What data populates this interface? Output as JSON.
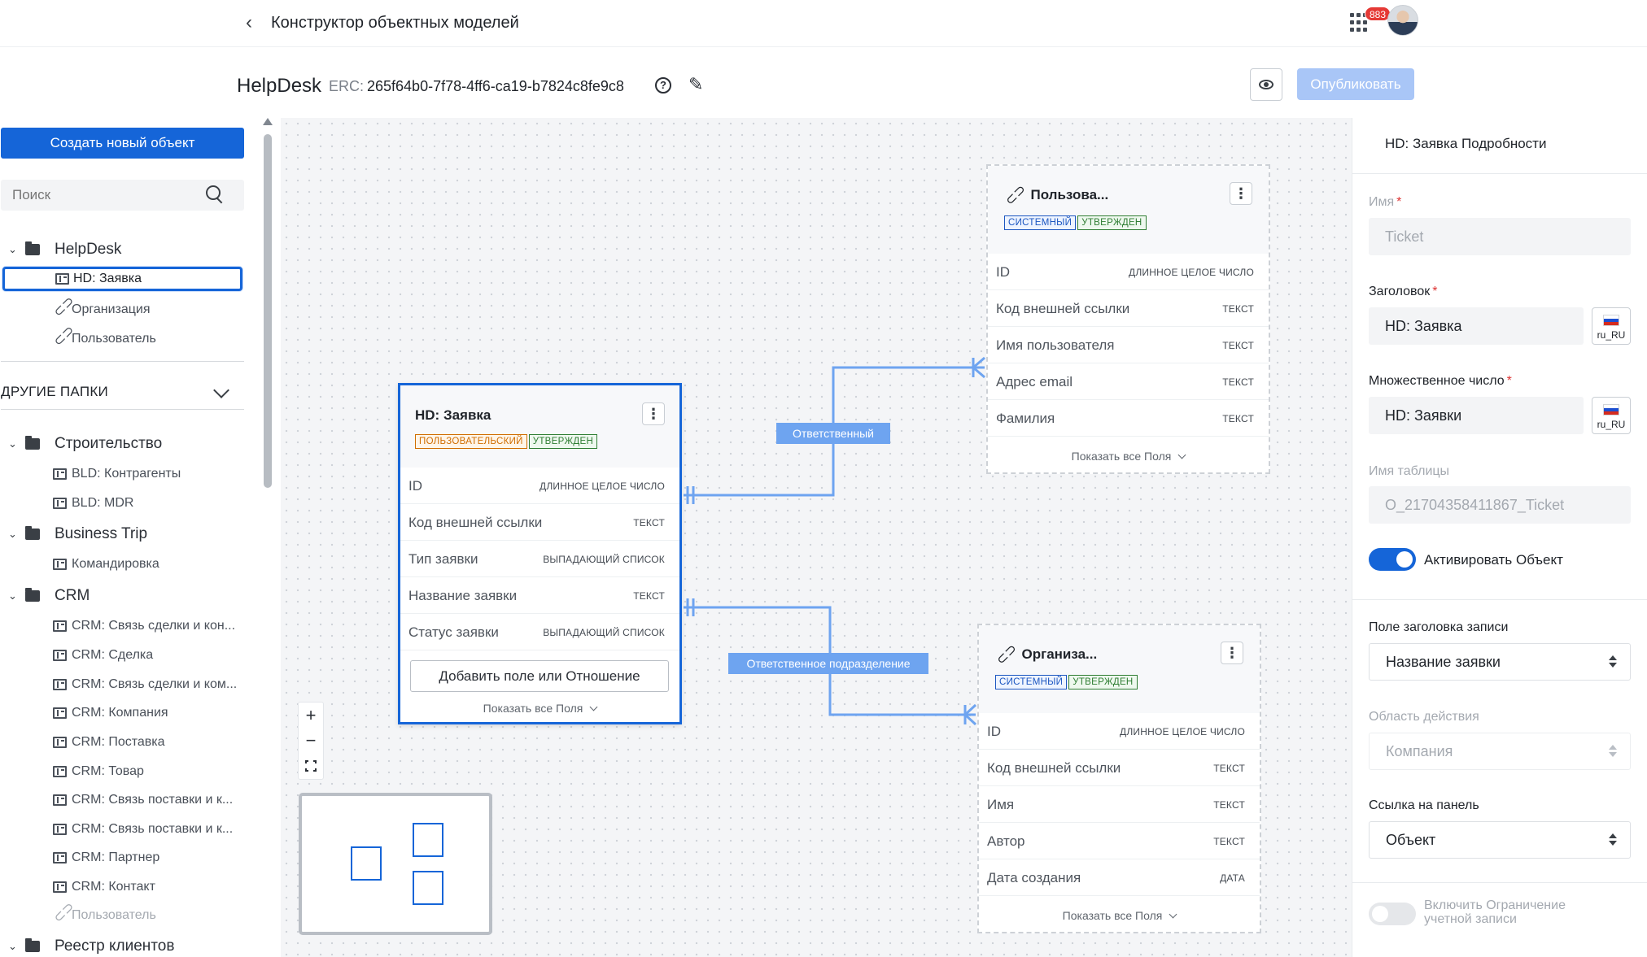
{
  "header": {
    "title": "Конструктор объектных моделей",
    "notifications_count": "883"
  },
  "model": {
    "name": "HelpDesk",
    "erc_label": "ERC:",
    "erc_value": "265f64b0-7f78-4ff6-ca19-b7824c8fe9c8",
    "publish_label": "Опубликовать"
  },
  "sidebar": {
    "create_label": "Создать новый объект",
    "search_placeholder": "Поиск",
    "folder": {
      "label": "HelpDesk",
      "items": [
        {
          "label": "HD: Заявка",
          "type": "object"
        },
        {
          "label": "Организация",
          "type": "link"
        },
        {
          "label": "Пользователь",
          "type": "link"
        }
      ]
    },
    "other_folders_label": "ДРУГИЕ ПАПКИ",
    "groups": [
      {
        "label": "Строительство",
        "items": [
          "BLD: Контрагенты",
          "BLD: MDR"
        ]
      },
      {
        "label": "Business Trip",
        "items": [
          "Командировка"
        ]
      },
      {
        "label": "CRM",
        "items": [
          "CRM: Связь сделки и кон...",
          "CRM: Сделка",
          "CRM: Связь сделки и ком...",
          "CRM: Компания",
          "CRM: Поставка",
          "CRM: Товар",
          "CRM: Связь поставки и к...",
          "CRM: Связь поставки и к...",
          "CRM: Партнер",
          "CRM: Контакт"
        ],
        "link_item": "Пользователь"
      },
      {
        "label": "Реестр клиентов",
        "items": []
      }
    ]
  },
  "canvas": {
    "badges": {
      "system": "СИСТЕМНЫЙ",
      "approved": "УТВЕРЖДЕН",
      "custom": "ПОЛЬЗОВАТЕЛЬСКИЙ"
    },
    "show_all_label": "Показать все Поля",
    "ticket": {
      "title": "HD: Заявка",
      "fields": [
        {
          "name": "ID",
          "type": "ДЛИННОЕ ЦЕЛОЕ ЧИСЛО"
        },
        {
          "name": "Код внешней ссылки",
          "type": "ТЕКСТ"
        },
        {
          "name": "Тип заявки",
          "type": "ВЫПАДАЮЩИЙ СПИСОК"
        },
        {
          "name": "Название заявки",
          "type": "ТЕКСТ"
        },
        {
          "name": "Статус заявки",
          "type": "ВЫПАДАЮЩИЙ СПИСОК"
        }
      ],
      "add_label": "Добавить поле или Отношение"
    },
    "user": {
      "title": "Пользова...",
      "fields": [
        {
          "name": "ID",
          "type": "ДЛИННОЕ ЦЕЛОЕ ЧИСЛО"
        },
        {
          "name": "Код внешней ссылки",
          "type": "ТЕКСТ"
        },
        {
          "name": "Имя пользователя",
          "type": "ТЕКСТ"
        },
        {
          "name": "Адрес email",
          "type": "ТЕКСТ"
        },
        {
          "name": "Фамилия",
          "type": "ТЕКСТ"
        }
      ]
    },
    "org": {
      "title": "Организа...",
      "fields": [
        {
          "name": "ID",
          "type": "ДЛИННОЕ ЦЕЛОЕ ЧИСЛО"
        },
        {
          "name": "Код внешней ссылки",
          "type": "ТЕКСТ"
        },
        {
          "name": "Имя",
          "type": "ТЕКСТ"
        },
        {
          "name": "Автор",
          "type": "ТЕКСТ"
        },
        {
          "name": "Дата создания",
          "type": "ДАТА"
        }
      ]
    },
    "relations": {
      "responsible": "Ответственный",
      "responsible_dept": "Ответственное подразделение"
    }
  },
  "details": {
    "title": "HD: Заявка Подробности",
    "name_label": "Имя",
    "name_value": "Ticket",
    "heading_label": "Заголовок",
    "heading_value": "HD: Заявка",
    "plural_label": "Множественное число",
    "plural_value": "HD: Заявки",
    "locale": "ru_RU",
    "table_label": "Имя таблицы",
    "table_value": "O_21704358411867_Ticket",
    "activate_label": "Активировать Объект",
    "record_title_label": "Поле заголовка записи",
    "record_title_value": "Название заявки",
    "scope_label": "Область действия",
    "scope_value": "Компания",
    "panel_link_label": "Ссылка на панель",
    "panel_link_value": "Объект",
    "restrict_label": "Включить Ограничение учетной записи"
  },
  "colors": {
    "primary": "#1565d8",
    "relation": "#6ea4f0",
    "badge_red": "#e53935"
  }
}
